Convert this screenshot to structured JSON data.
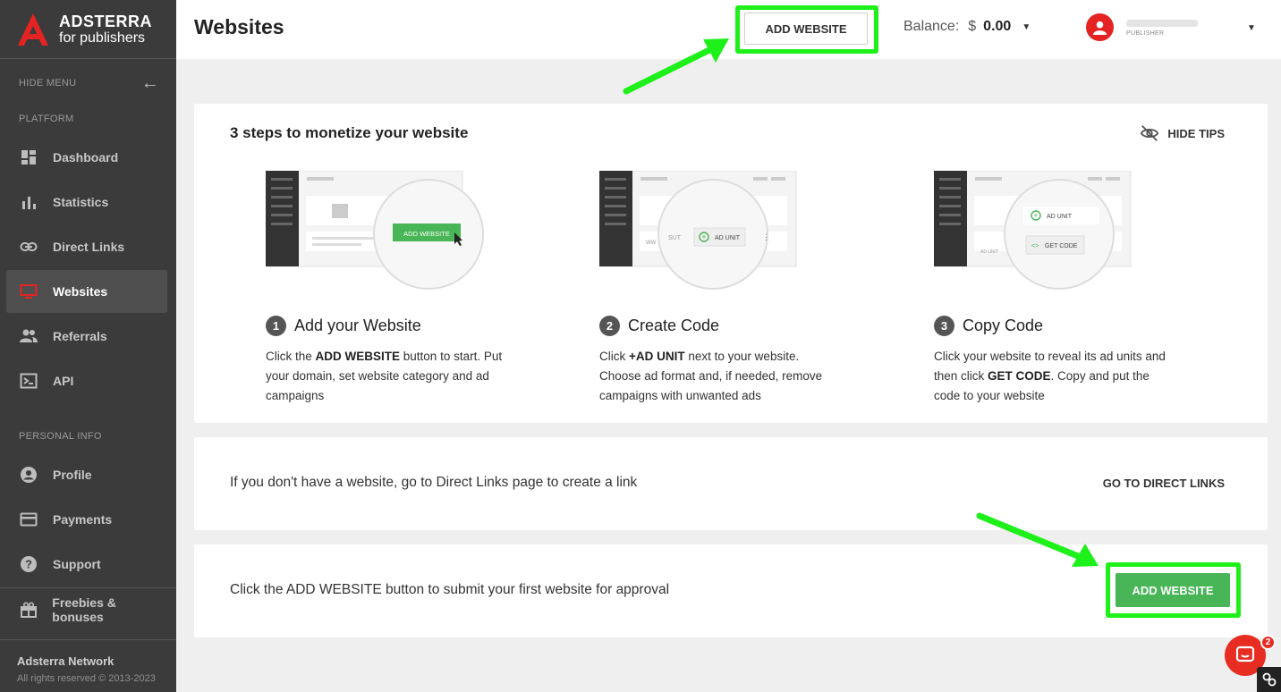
{
  "sidebar": {
    "brand": "ADSTERRA",
    "brand_sub": "for publishers",
    "hide_menu": "HIDE MENU",
    "platform_label": "PLATFORM",
    "platform_items": [
      {
        "label": "Dashboard",
        "icon": "dashboard-icon"
      },
      {
        "label": "Statistics",
        "icon": "bar-chart-icon"
      },
      {
        "label": "Direct Links",
        "icon": "link-icon"
      },
      {
        "label": "Websites",
        "icon": "monitor-icon",
        "active": true
      },
      {
        "label": "Referrals",
        "icon": "people-icon"
      },
      {
        "label": "API",
        "icon": "terminal-icon"
      }
    ],
    "personal_label": "PERSONAL INFO",
    "personal_items": [
      {
        "label": "Profile",
        "icon": "account-icon"
      },
      {
        "label": "Payments",
        "icon": "card-icon"
      },
      {
        "label": "Support",
        "icon": "help-icon"
      }
    ],
    "freebies": "Freebies & bonuses",
    "footer_title": "Adsterra Network",
    "footer_copy": "All rights reserved © 2013-2023"
  },
  "header": {
    "title": "Websites",
    "add_website": "ADD WEBSITE",
    "balance_label": "Balance:",
    "currency": "$",
    "balance_value": "0.00",
    "user_role": "PUBLISHER"
  },
  "tips": {
    "title": "3 steps to monetize your website",
    "hide_tips": "HIDE TIPS",
    "steps": [
      {
        "num": "1",
        "title": "Add your Website",
        "desc_pre": "Click the ",
        "desc_bold": "ADD WEBSITE",
        "desc_post": " button to start. Put your domain, set website category and ad campaigns",
        "illus_btn": "ADD WEBSITE"
      },
      {
        "num": "2",
        "title": "Create Code",
        "desc_pre": "Click ",
        "desc_bold": "+AD UNIT",
        "desc_post": " next to your website. Choose ad format and, if needed, remove campaigns with unwanted ads",
        "illus_btn": "AD UNIT"
      },
      {
        "num": "3",
        "title": "Copy Code",
        "desc_pre": "Click your website to reveal its ad units and then click ",
        "desc_bold": "GET CODE",
        "desc_post": ". Copy and put the code to your website",
        "illus_btn": "AD UNIT",
        "illus_btn2": "GET CODE"
      }
    ]
  },
  "direct_links": {
    "text": "If you don't have a website, go to Direct Links page to create a link",
    "link": "GO TO DIRECT LINKS"
  },
  "submit": {
    "text": "Click the ADD WEBSITE button to submit your first website for approval",
    "button": "ADD WEBSITE"
  },
  "chat": {
    "badge": "2"
  },
  "colors": {
    "highlight": "#1ef01a",
    "brand_red": "#e52323",
    "green_button": "#48b556",
    "sidebar_bg": "#3b3b3b"
  }
}
